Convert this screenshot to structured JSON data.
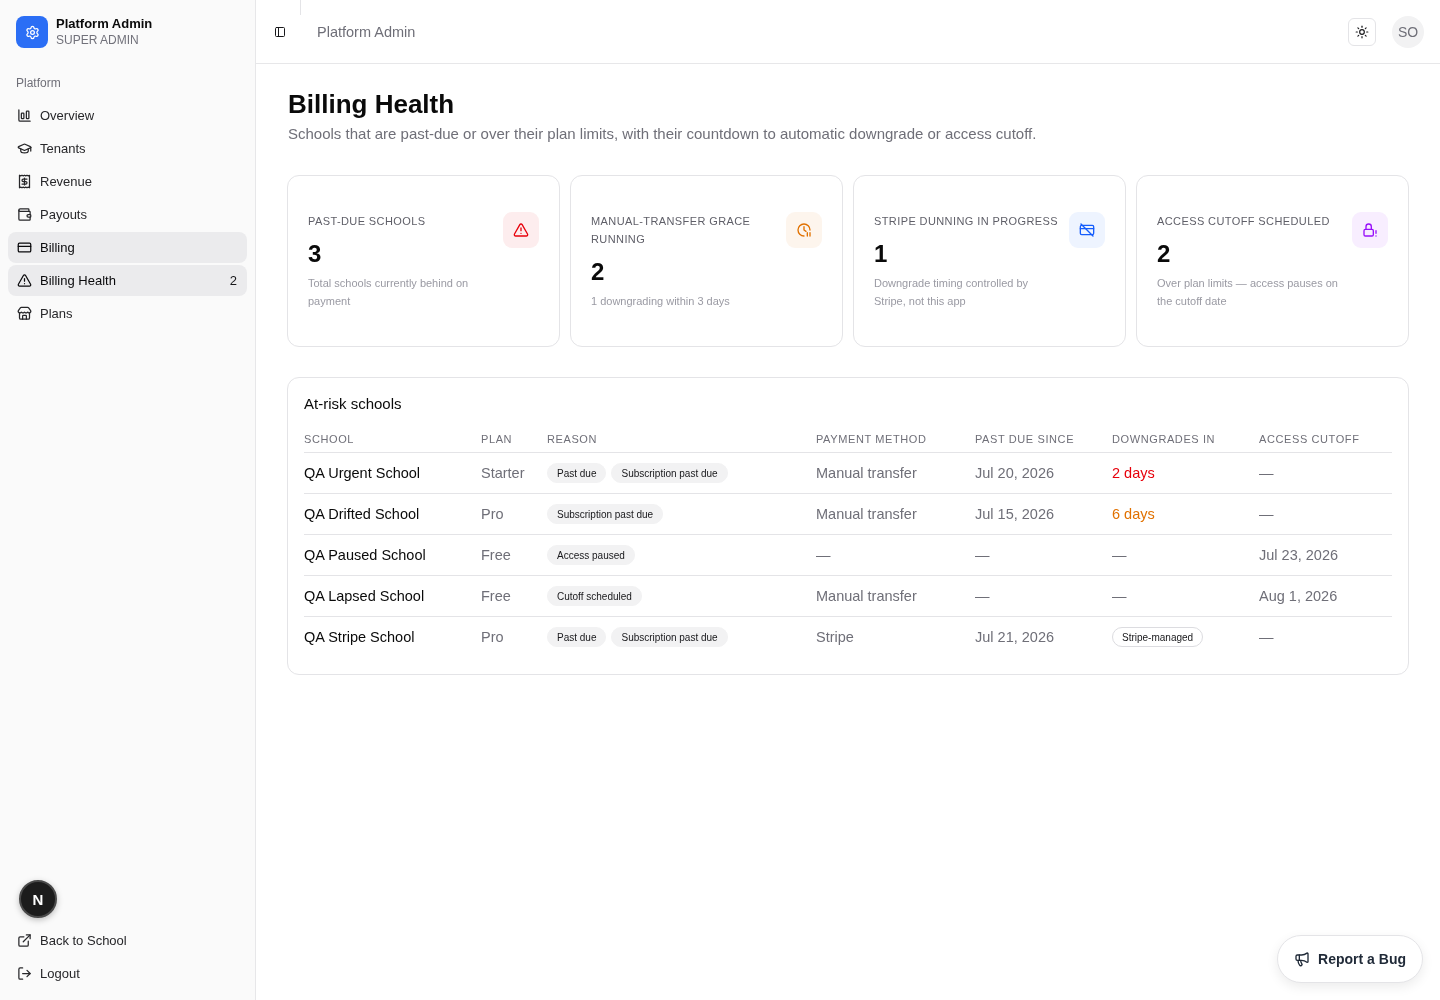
{
  "sidebar": {
    "brand": {
      "title": "Platform Admin",
      "subtitle": "SUPER ADMIN"
    },
    "group_label": "Platform",
    "items": [
      {
        "label": "Overview",
        "selected": false
      },
      {
        "label": "Tenants",
        "selected": false
      },
      {
        "label": "Revenue",
        "selected": false
      },
      {
        "label": "Payouts",
        "selected": false
      },
      {
        "label": "Billing",
        "selected": true
      },
      {
        "label": "Billing Health",
        "count": "2",
        "selected": true
      },
      {
        "label": "Plans",
        "selected": false
      }
    ],
    "footer_items": [
      {
        "label": "Back to School"
      },
      {
        "label": "Logout"
      }
    ]
  },
  "topbar": {
    "title": "Platform Admin",
    "avatar": "SO"
  },
  "page": {
    "title": "Billing Health",
    "description": "Schools that are past-due or over their plan limits, with their countdown to automatic downgrade or access cutoff."
  },
  "cards": [
    {
      "label": "PAST-DUE SCHOOLS",
      "value": "3",
      "note": "Total schools currently behind on payment",
      "color": "#e7000b"
    },
    {
      "label": "MANUAL-TRANSFER GRACE RUNNING",
      "value": "2",
      "note": "1 downgrading within 3 days",
      "color": "#e17100"
    },
    {
      "label": "STRIPE DUNNING IN PROGRESS",
      "value": "1",
      "note": "Downgrade timing controlled by Stripe, not this app",
      "color": "#155dfc"
    },
    {
      "label": "ACCESS CUTOFF SCHEDULED",
      "value": "2",
      "note": "Over plan limits — access pauses on the cutoff date",
      "color": "#9810fa"
    }
  ],
  "table": {
    "title": "At-risk schools",
    "columns": [
      "SCHOOL",
      "PLAN",
      "REASON",
      "PAYMENT METHOD",
      "PAST DUE SINCE",
      "DOWNGRADES IN",
      "ACCESS CUTOFF"
    ],
    "rows": [
      {
        "school": "QA Urgent School",
        "plan": "Starter",
        "reasons": [
          "Past due",
          "Subscription past due"
        ],
        "payment_method": "Manual transfer",
        "past_due_since": "Jul 20, 2026",
        "downgrades_in": {
          "kind": "text",
          "text": "2 days",
          "color": "#e7000b"
        },
        "access_cutoff": "—"
      },
      {
        "school": "QA Drifted School",
        "plan": "Pro",
        "reasons": [
          "Subscription past due"
        ],
        "payment_method": "Manual transfer",
        "past_due_since": "Jul 15, 2026",
        "downgrades_in": {
          "kind": "text",
          "text": "6 days",
          "color": "#e17100"
        },
        "access_cutoff": "—"
      },
      {
        "school": "QA Paused School",
        "plan": "Free",
        "reasons": [
          "Access paused"
        ],
        "payment_method": "—",
        "past_due_since": "—",
        "downgrades_in": {
          "kind": "text",
          "text": "—"
        },
        "access_cutoff": "Jul 23, 2026"
      },
      {
        "school": "QA Lapsed School",
        "plan": "Free",
        "reasons": [
          "Cutoff scheduled"
        ],
        "payment_method": "Manual transfer",
        "past_due_since": "—",
        "downgrades_in": {
          "kind": "text",
          "text": "—"
        },
        "access_cutoff": "Aug 1, 2026"
      },
      {
        "school": "QA Stripe School",
        "plan": "Pro",
        "reasons": [
          "Past due",
          "Subscription past due"
        ],
        "payment_method": "Stripe",
        "past_due_since": "Jul 21, 2026",
        "downgrades_in": {
          "kind": "badge",
          "text": "Stripe-managed"
        },
        "access_cutoff": "—"
      }
    ]
  },
  "report_button": {
    "label": "Report a Bug"
  },
  "dev_badge": {
    "label": "N"
  }
}
